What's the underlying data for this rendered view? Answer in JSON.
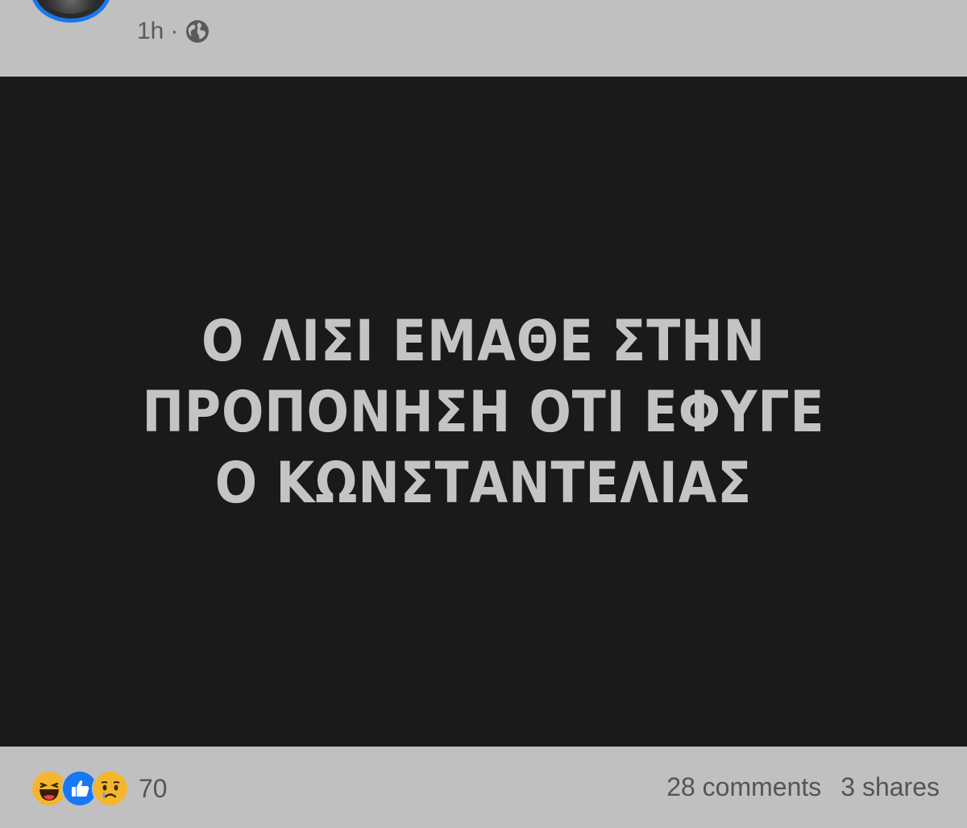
{
  "post": {
    "time": "1h",
    "separator": "·",
    "privacy_icon": "globe-icon",
    "image_text": "Ο ΛΙΣΙ ΕΜΑΘΕ ΣΤΗΝ ΠΡΟΠΟΝΗΣΗ ΟΤΙ ΕΦΥΓΕ Ο ΚΩΝΣΤΑΝΤΕΛΙΑΣ"
  },
  "reactions": {
    "icons": [
      "haha-icon",
      "like-icon",
      "sad-icon"
    ],
    "count": "70"
  },
  "stats": {
    "comments": "28 comments",
    "shares": "3 shares"
  },
  "colors": {
    "background": "#c0c0c0",
    "image_background": "#1a1a1a",
    "image_text": "#c4c4c4",
    "accent": "#1877f2"
  }
}
